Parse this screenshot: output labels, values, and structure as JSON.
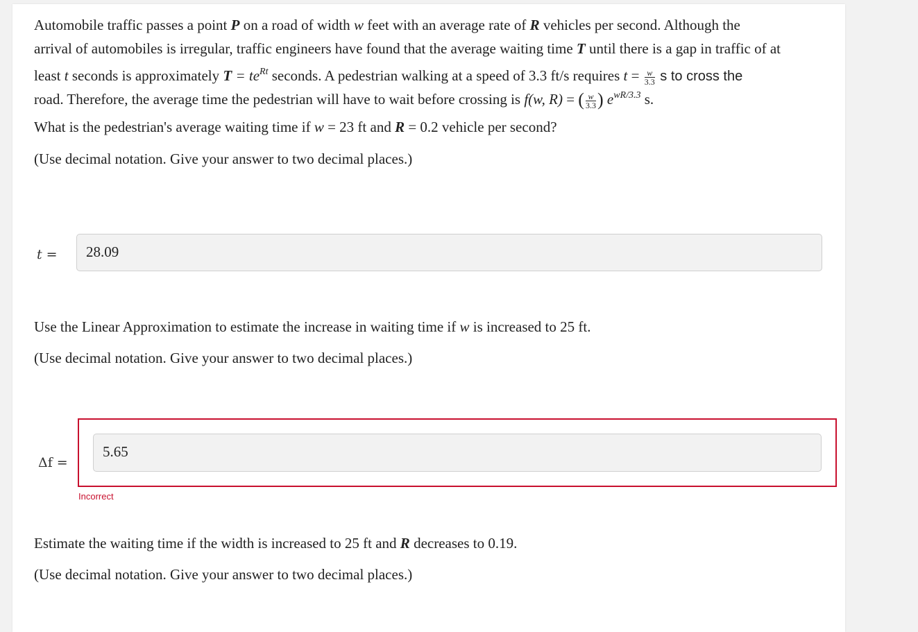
{
  "intro": {
    "l1_a": "Automobile traffic passes a point ",
    "P": "P",
    "l1_b": " on a road of width ",
    "w1": "w",
    "l1_c": " feet with an average rate of ",
    "R1": "R",
    "l1_d": " vehicles per second. Although the",
    "l2_a": "arrival of automobiles is irregular, traffic engineers have found that the average waiting time ",
    "T1": "T",
    "l2_b": " until there is a gap in traffic of at",
    "l3_a": "least ",
    "t1": "t",
    "l3_b": " seconds is approximately ",
    "T2": "T",
    "l3_eq": " = te",
    "l3_exp": "Rt",
    "l3_c": " seconds. A pedestrian walking at a speed of 3.3 ft/s requires ",
    "t2": "t",
    "l3_eq2": " = ",
    "frac_num": "w",
    "frac_den": "3.3",
    "l3_d": " s to cross the",
    "l4_a": "road. Therefore, the average time the pedestrian will have to wait before crossing is ",
    "fwR": "f(w, R)",
    "l4_eq": " = ",
    "paren_open": "(",
    "paren_close": ")",
    "e": "e",
    "exp2": "wR/3.3",
    "l4_s": " s."
  },
  "q1": {
    "text_a": "What is the pedestrian's average waiting time if ",
    "w": "w",
    "text_b": " = 23 ft and ",
    "R": "R",
    "text_c": " = 0.2 vehicle per second?",
    "note": "(Use decimal notation. Give your answer to two decimal places.)",
    "label": "t =",
    "answer": "28.09"
  },
  "q2": {
    "text_a": "Use the Linear Approximation to estimate the increase in waiting time if ",
    "w": "w",
    "text_b": " is increased to 25 ft.",
    "note": "(Use decimal notation. Give your answer to two decimal places.)",
    "label": "Δf =",
    "answer": "5.65",
    "feedback": "Incorrect"
  },
  "q3": {
    "text_a": "Estimate the waiting time if the width is increased to 25 ft and ",
    "R": "R",
    "text_b": " decreases to 0.19.",
    "note": "(Use decimal notation. Give your answer to two decimal places.)"
  },
  "colors": {
    "error": "#c8102e",
    "input_bg": "#f2f2f2",
    "page_bg": "#f2f2f2"
  }
}
